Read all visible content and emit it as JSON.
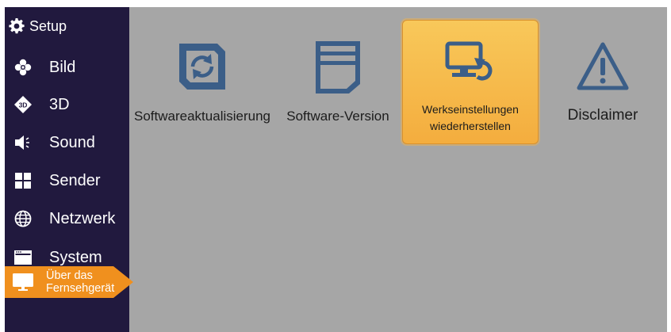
{
  "sidebar": {
    "header": {
      "label": "Setup",
      "icon": "gear-icon"
    },
    "items": [
      {
        "label": "Bild",
        "icon": "flower-icon"
      },
      {
        "label": "3D",
        "icon": "3d-icon"
      },
      {
        "label": "Sound",
        "icon": "speaker-icon"
      },
      {
        "label": "Sender",
        "icon": "grid-icon"
      },
      {
        "label": "Netzwerk",
        "icon": "globe-icon"
      },
      {
        "label": "System",
        "icon": "window-icon"
      },
      {
        "label": "Über das\nFernsehgerät",
        "icon": "tv-icon",
        "active": true
      }
    ]
  },
  "main": {
    "tiles": [
      {
        "label": "Softwareaktualisierung",
        "icon": "refresh-icon"
      },
      {
        "label": "Software-Version",
        "icon": "document-icon"
      },
      {
        "label": "Werkseinstellungen wiederherstellen",
        "icon": "monitor-reset-icon",
        "selected": true
      },
      {
        "label": "Disclaimer",
        "icon": "warning-icon"
      }
    ]
  },
  "colors": {
    "sidebar_bg": "#21193e",
    "content_bg": "#a6a6a6",
    "accent": "#f0901e",
    "selected_tile": "#f6b64a",
    "icon_blue": "#3b5e88"
  }
}
